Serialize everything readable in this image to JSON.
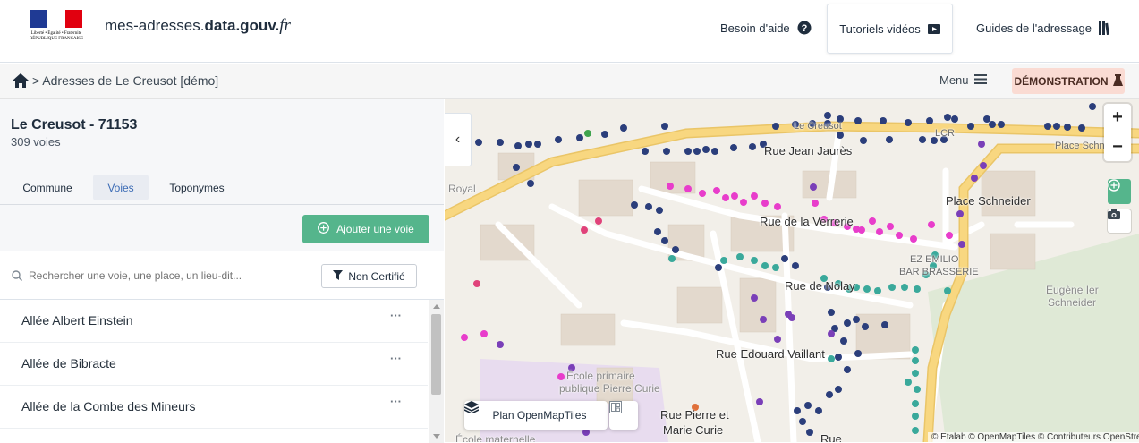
{
  "header": {
    "logo_text": "Liberté • Égalité • Fraternité RÉPUBLIQUE FRANÇAISE",
    "site_prefix": "mes-adresses.",
    "site_bold": "data.gouv.",
    "site_suffix": "fr",
    "nav": {
      "help_label": "Besoin d'aide",
      "tutorials_label": "Tutoriels vidéos",
      "guides_label": "Guides de l'adressage"
    }
  },
  "subbar": {
    "breadcrumb": "> Adresses de Le Creusot [démo]",
    "menu_label": "Menu",
    "demo_label": "DÉMONSTRATION"
  },
  "sidebar": {
    "commune_name": "Le Creusot - 71153",
    "voies_count": "309 voies",
    "tabs": [
      "Commune",
      "Voies",
      "Toponymes"
    ],
    "active_tab": "Voies",
    "add_label": "Ajouter une voie",
    "search_placeholder": "Rechercher une voie, une place, un lieu-dit...",
    "filter_label": "Non Certifié",
    "voies": [
      {
        "name": "Allée Albert Einstein"
      },
      {
        "name": "Allée de Bibracte"
      },
      {
        "name": "Allée de la Combe des Mineurs"
      }
    ]
  },
  "map": {
    "labels": {
      "rue_jean_jaures": "Rue Jean Jaurès",
      "rue_verrerie": "Rue de la Verrerie",
      "place_schneider": "Place Schneider",
      "rue_nolay": "Rue de Nolay",
      "rue_edouard_vaillant": "Rue Edouard Vaillant",
      "rue_pierre_marie_curie_1": "Rue Pierre et",
      "rue_pierre_marie_curie_2": "Marie Curie",
      "ecole_primaire_1": "École primaire",
      "ecole_primaire_2": "publique Pierre Curie",
      "ecole_maternelle": "École maternelle",
      "eugene_1": "Eugène Ier",
      "eugene_2": "Schneider",
      "ez_emilio_1": "EZ EMILIO",
      "ez_emilio_2": "BAR BRASSERIE",
      "royal": "Royal",
      "le_creusot": "Le Creusot",
      "lcr": "LCR",
      "place_schn": "Place Schn",
      "rue_partial": "Rue"
    },
    "style_label": "Plan OpenMapTiles",
    "attribution": "© Etalab © OpenMapTiles © Contributeurs OpenStreetMap",
    "colors": {
      "navy": "#2b3e7b",
      "teal": "#3aa99b",
      "magenta": "#e83dcb",
      "purple": "#7a3fb8",
      "pink_red": "#e0427a",
      "green": "#3fa34d",
      "orange": "#e0703a",
      "road": "#f8d780",
      "accent_green": "#55b58c",
      "demo_badge": "#fadbd3"
    }
  }
}
